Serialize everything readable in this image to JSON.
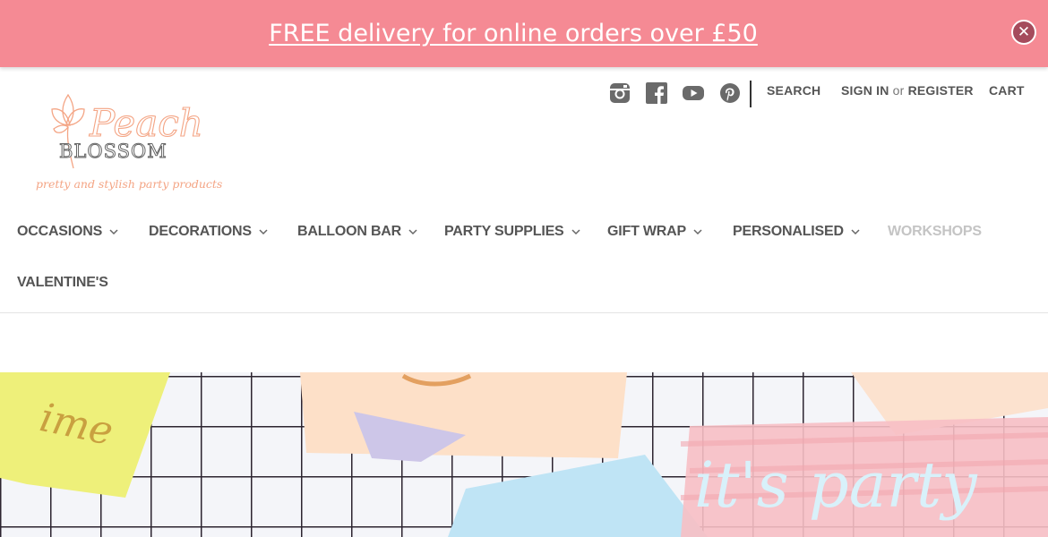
{
  "banner": {
    "text": "FREE delivery for online orders over £50",
    "close_icon": "close-icon",
    "color": "#f58a94"
  },
  "logo": {
    "line1": "Peach",
    "line2": "BLOSSOM",
    "tagline": "pretty and stylish party products"
  },
  "social": [
    "instagram-icon",
    "facebook-icon",
    "youtube-icon",
    "pinterest-icon"
  ],
  "utility": {
    "search": "SEARCH",
    "sign_in": "SIGN IN",
    "or": "or",
    "register": "REGISTER",
    "cart": "CART"
  },
  "nav": {
    "items": [
      {
        "label": "OCCASIONS",
        "has_dropdown": true
      },
      {
        "label": "DECORATIONS",
        "has_dropdown": true
      },
      {
        "label": "BALLOON BAR",
        "has_dropdown": true
      },
      {
        "label": "PARTY SUPPLIES",
        "has_dropdown": true
      },
      {
        "label": "GIFT WRAP",
        "has_dropdown": true
      },
      {
        "label": "PERSONALISED",
        "has_dropdown": true
      },
      {
        "label": "WORKSHOPS",
        "has_dropdown": false
      },
      {
        "label": "VALENTINE'S",
        "has_dropdown": false
      }
    ]
  },
  "hero": {
    "cup_text": "ime",
    "overlay_text": "it's party"
  }
}
